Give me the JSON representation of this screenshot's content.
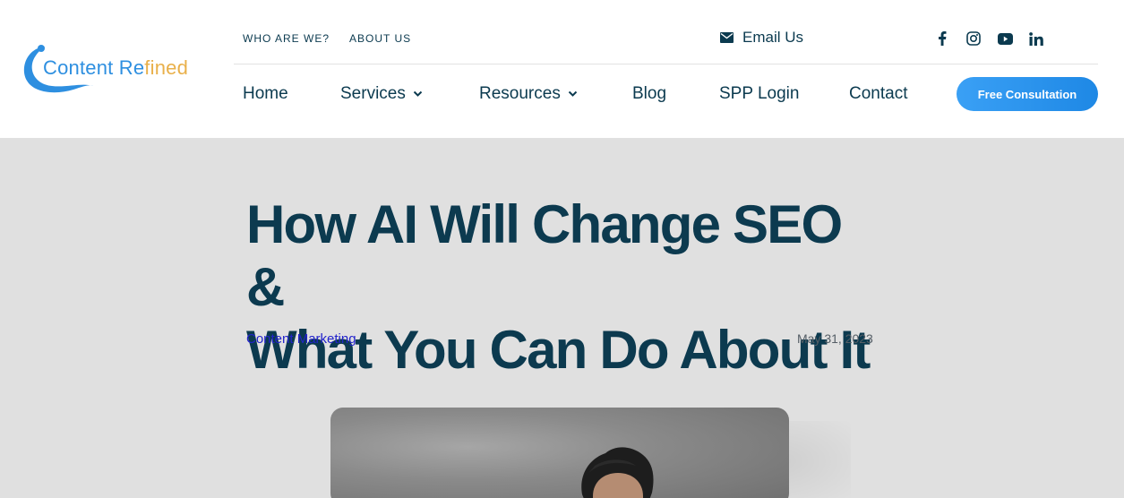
{
  "logo": {
    "part1": "Content Re",
    "part2": "fined"
  },
  "topbar": {
    "links": [
      "WHO ARE WE?",
      "ABOUT US"
    ],
    "email_label": "Email Us",
    "socials": [
      "facebook-icon",
      "instagram-icon",
      "youtube-icon",
      "linkedin-icon"
    ]
  },
  "nav": {
    "items": [
      {
        "label": "Home"
      },
      {
        "label": "Services"
      },
      {
        "label": "Resources"
      },
      {
        "label": "Blog"
      },
      {
        "label": "SPP Login"
      },
      {
        "label": "Contact"
      }
    ],
    "cta_label": "Free Consultation"
  },
  "article": {
    "title_line1": "How AI Will Change SEO &",
    "title_line2": "What You Can Do About It",
    "category": "Content Marketing",
    "date": "May 31, 2023"
  },
  "colors": {
    "brand_blue": "#2e8fe0",
    "brand_gold": "#e9b04a",
    "heading": "#0c3a4f",
    "cta": "#1e88e5",
    "page_bg": "#e0e0e0"
  }
}
